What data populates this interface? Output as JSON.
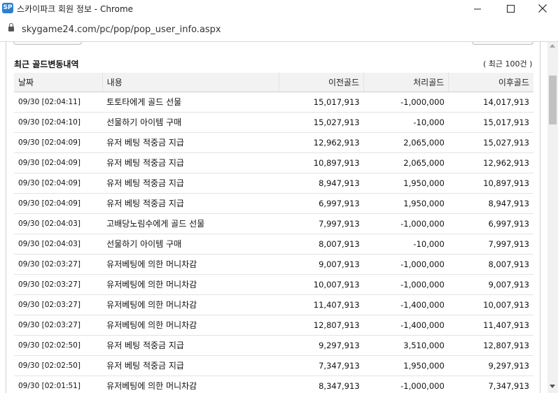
{
  "window": {
    "app_icon_text": "SP",
    "title": "스카이파크 회원 정보 - Chrome",
    "url": "skygame24.com/pc/pop/pop_user_info.aspx"
  },
  "section": {
    "title": "최근 골드변동내역",
    "count_label": "( 최근 100건 )"
  },
  "table": {
    "headers": {
      "date": "날짜",
      "desc": "내용",
      "before": "이전골드",
      "change": "처리골드",
      "after": "이후골드"
    },
    "rows": [
      {
        "date": "09/30 [02:04:11]",
        "desc": "토토타에게 골드 선물",
        "before": "15,017,913",
        "change": "-1,000,000",
        "after": "14,017,913"
      },
      {
        "date": "09/30 [02:04:10]",
        "desc": "선물하기 아이템 구매",
        "before": "15,027,913",
        "change": "-10,000",
        "after": "15,017,913"
      },
      {
        "date": "09/30 [02:04:09]",
        "desc": "유저 베팅 적중금 지급",
        "before": "12,962,913",
        "change": "2,065,000",
        "after": "15,027,913"
      },
      {
        "date": "09/30 [02:04:09]",
        "desc": "유저 베팅 적중금 지급",
        "before": "10,897,913",
        "change": "2,065,000",
        "after": "12,962,913"
      },
      {
        "date": "09/30 [02:04:09]",
        "desc": "유저 베팅 적중금 지급",
        "before": "8,947,913",
        "change": "1,950,000",
        "after": "10,897,913"
      },
      {
        "date": "09/30 [02:04:09]",
        "desc": "유저 베팅 적중금 지급",
        "before": "6,997,913",
        "change": "1,950,000",
        "after": "8,947,913"
      },
      {
        "date": "09/30 [02:04:03]",
        "desc": "고배당노림수에게 골드 선물",
        "before": "7,997,913",
        "change": "-1,000,000",
        "after": "6,997,913"
      },
      {
        "date": "09/30 [02:04:03]",
        "desc": "선물하기 아이템 구매",
        "before": "8,007,913",
        "change": "-10,000",
        "after": "7,997,913"
      },
      {
        "date": "09/30 [02:03:27]",
        "desc": "유저베팅에 의한 머니차감",
        "before": "9,007,913",
        "change": "-1,000,000",
        "after": "8,007,913"
      },
      {
        "date": "09/30 [02:03:27]",
        "desc": "유저베팅에 의한 머니차감",
        "before": "10,007,913",
        "change": "-1,000,000",
        "after": "9,007,913"
      },
      {
        "date": "09/30 [02:03:27]",
        "desc": "유저베팅에 의한 머니차감",
        "before": "11,407,913",
        "change": "-1,400,000",
        "after": "10,007,913"
      },
      {
        "date": "09/30 [02:03:27]",
        "desc": "유저베팅에 의한 머니차감",
        "before": "12,807,913",
        "change": "-1,400,000",
        "after": "11,407,913"
      },
      {
        "date": "09/30 [02:02:50]",
        "desc": "유저 베팅 적중금 지급",
        "before": "9,297,913",
        "change": "3,510,000",
        "after": "12,807,913"
      },
      {
        "date": "09/30 [02:02:50]",
        "desc": "유저 베팅 적중금 지급",
        "before": "7,347,913",
        "change": "1,950,000",
        "after": "9,297,913"
      },
      {
        "date": "09/30 [02:01:51]",
        "desc": "유저베팅에 의한 머니차감",
        "before": "8,347,913",
        "change": "-1,000,000",
        "after": "7,347,913"
      }
    ]
  }
}
